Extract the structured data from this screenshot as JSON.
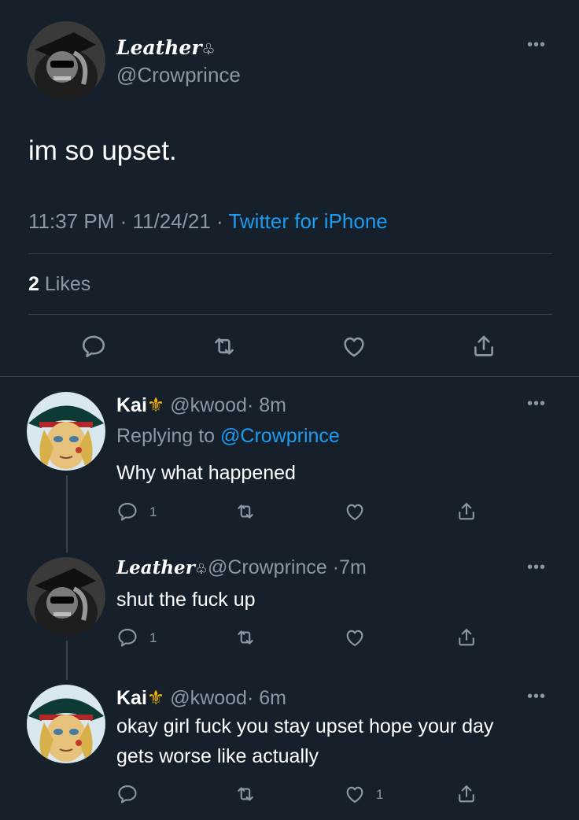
{
  "main_tweet": {
    "display_name": "Leather",
    "name_emoji": "♧",
    "handle": "@Crowprince",
    "text": "im so upset.",
    "time": "11:37 PM",
    "date": "11/24/21",
    "source": "Twitter for iPhone",
    "likes_count": "2",
    "likes_label": "Likes"
  },
  "replies": [
    {
      "display_name": "Kai",
      "name_emoji": "⚜",
      "handle": "@kwood",
      "time": "8m",
      "replying_prefix": "Replying to",
      "replying_to": "@Crowprince",
      "text": "Why what happened",
      "reply_count": "1",
      "like_count": ""
    },
    {
      "display_name": "Leather",
      "name_emoji": "♧",
      "handle": "@Crowprince",
      "time": "7m",
      "text": "shut the fuck up",
      "reply_count": "1",
      "like_count": ""
    },
    {
      "display_name": "Kai",
      "name_emoji": "⚜",
      "handle": "@kwood",
      "time": "6m",
      "text_line1": "okay girl fuck you stay upset hope your day",
      "text_line2": "gets worse like actually",
      "reply_count": "",
      "like_count": "1"
    }
  ],
  "separator": "·",
  "more_icon": "•••",
  "icons": [
    "reply-icon",
    "retweet-icon",
    "like-icon",
    "share-icon",
    "more-icon"
  ],
  "colors": {
    "background": "#15202b",
    "muted": "#8b98a5",
    "link": "#1d9bf0",
    "divider": "#38444d",
    "kai_emoji": "#f4b400"
  }
}
